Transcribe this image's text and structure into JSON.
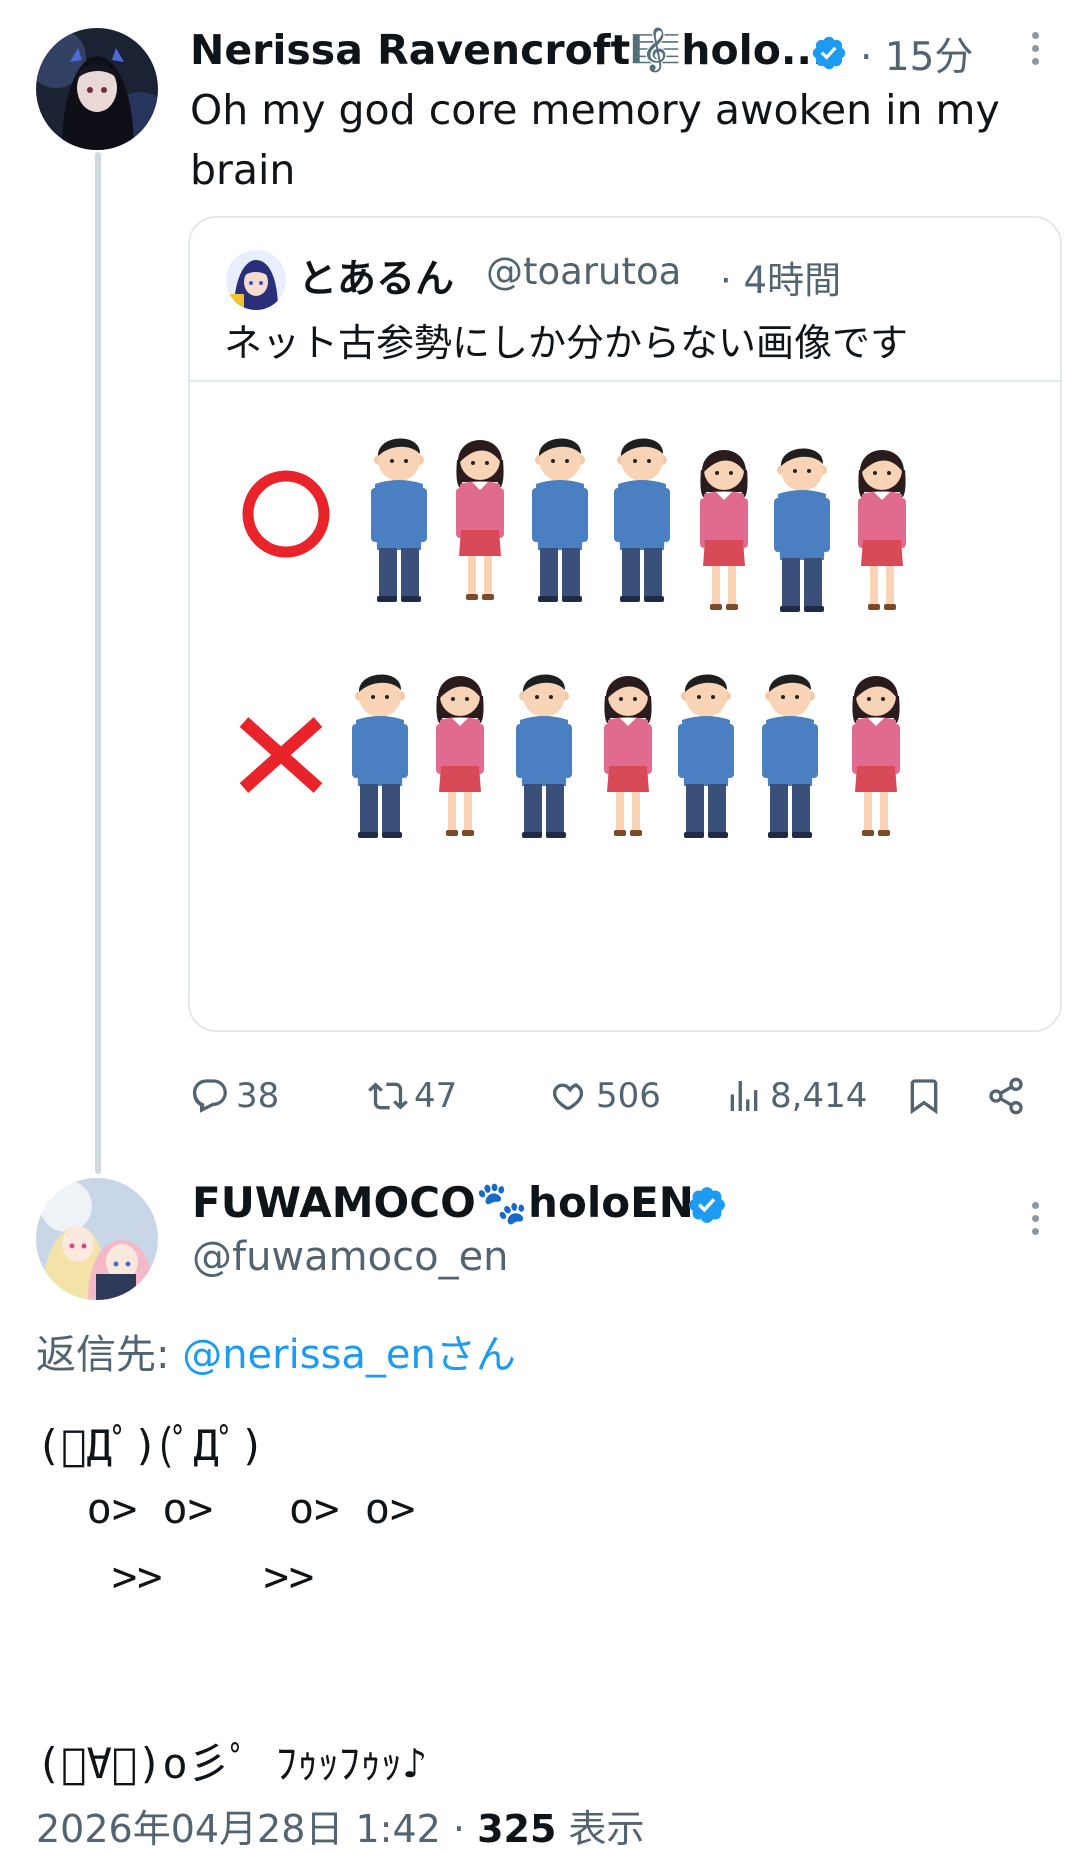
{
  "tweet": {
    "author_name": "Nerissa Ravencroft🎼holo...",
    "time_ago": "· 15分",
    "text_line1": "Oh my god core memory awoken in my",
    "text_line2": "brain",
    "quote": {
      "author_name": "とあるん",
      "handle": "@toarutoa",
      "time_ago": "· 4時間",
      "text": "ネット古参勢にしか分からない画像です"
    },
    "actions": {
      "replies": "38",
      "retweets": "47",
      "likes": "506",
      "views": "8,414"
    }
  },
  "reply": {
    "author_name": "FUWAMOCO🐾holoEN",
    "handle": "@fuwamoco_en",
    "reply_to_prefix": "返信先: ",
    "reply_to_handle": "@nerissa_enさん",
    "kaomoji": {
      "line1": "(ﾟДﾟ)(ﾟДﾟ)",
      "line2": "  o> o>   o> o>",
      "line3": "   >>    >>",
      "line4": "(ﾟ∀ﾟ)o彡ﾟ ﾌｩｯﾌｩｯ♪"
    },
    "timestamp": "2026年04月28日 1:42 · ",
    "view_count": "325",
    "view_label": " 表示"
  },
  "colors": {
    "verified": "#1d9bf0",
    "link": "#1d9bf0",
    "shirt_blue": "#4a7fc1",
    "shirt_pink": "#e06b8f",
    "mark_red": "#e8242a"
  }
}
